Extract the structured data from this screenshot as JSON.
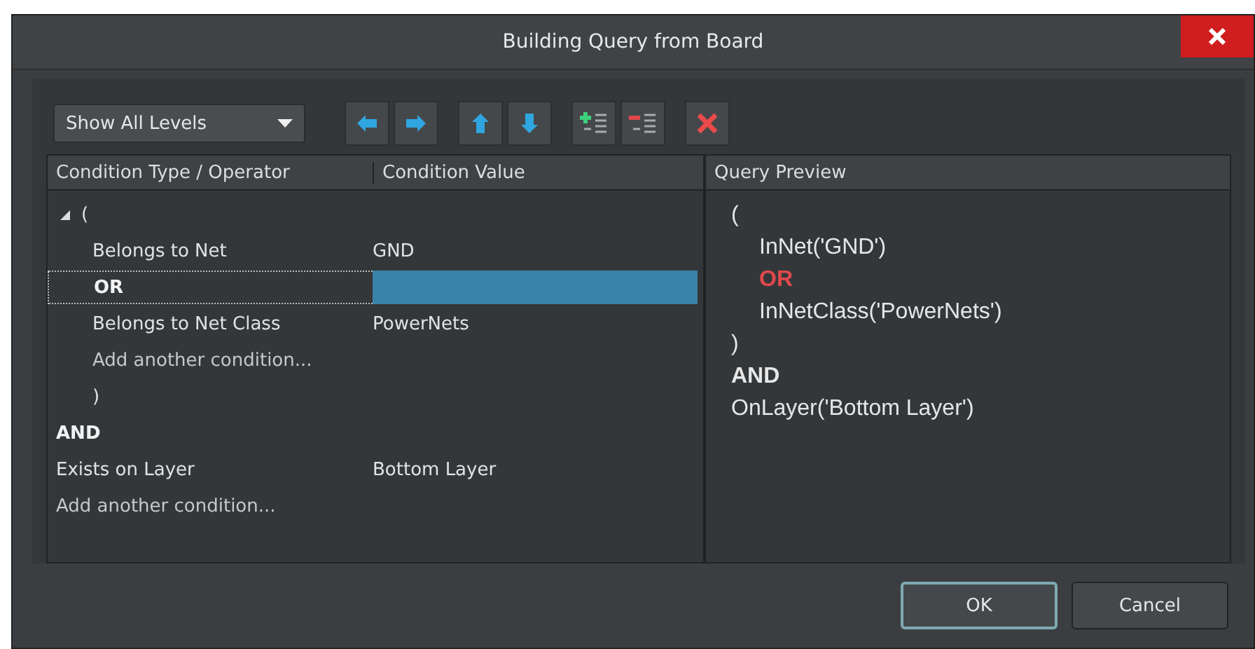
{
  "window": {
    "title": "Building Query from Board"
  },
  "toolbar": {
    "level_dropdown": {
      "value": "Show All Levels"
    }
  },
  "conditions": {
    "columns": [
      "Condition Type / Operator",
      "Condition Value"
    ],
    "rows": [
      {
        "kind": "paren",
        "type": "(",
        "expanded": true,
        "selected": false,
        "children": [
          {
            "kind": "condition",
            "type": "Belongs to Net",
            "value": "GND",
            "selected": false
          },
          {
            "kind": "operator",
            "type": "OR",
            "selected": true
          },
          {
            "kind": "condition",
            "type": "Belongs to Net Class",
            "value": "PowerNets",
            "selected": false
          },
          {
            "kind": "add",
            "type": "Add another condition...",
            "selected": false
          },
          {
            "kind": "paren",
            "type": ")",
            "selected": false
          }
        ]
      },
      {
        "kind": "operator",
        "type": "AND",
        "selected": false
      },
      {
        "kind": "condition",
        "type": "Exists on Layer",
        "value": "Bottom Layer",
        "selected": false
      },
      {
        "kind": "add",
        "type": "Add another condition...",
        "selected": false
      }
    ]
  },
  "preview": {
    "title": "Query Preview",
    "lines": [
      {
        "kind": "text",
        "text": "(",
        "children": [
          {
            "kind": "text",
            "text": "InNet('GND')"
          },
          {
            "kind": "operator",
            "text": "OR",
            "highlighted": true
          },
          {
            "kind": "text",
            "text": "InNetClass('PowerNets')"
          }
        ]
      },
      {
        "kind": "text",
        "text": ")"
      },
      {
        "kind": "operator",
        "text": "AND",
        "highlighted": false
      },
      {
        "kind": "text",
        "text": "OnLayer('Bottom Layer')"
      }
    ]
  },
  "buttons": [
    {
      "label": "OK",
      "default": true
    },
    {
      "label": "Cancel",
      "default": false
    }
  ]
}
